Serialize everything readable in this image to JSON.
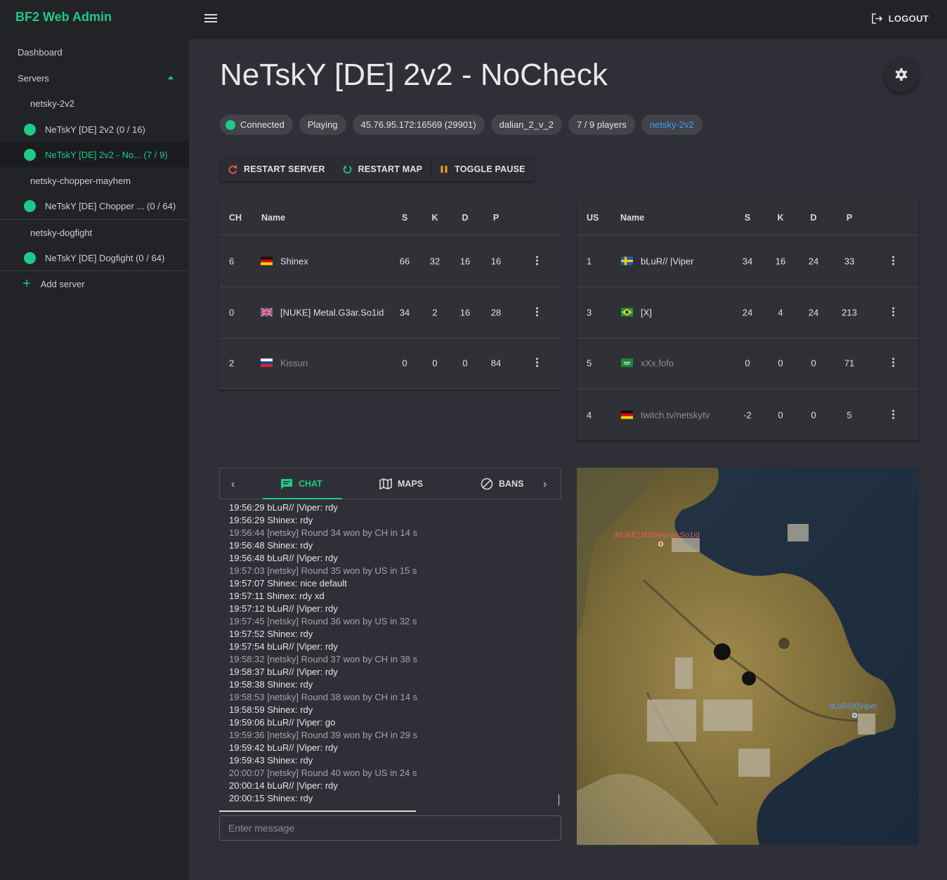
{
  "app": {
    "brand": "BF2 Web Admin",
    "logout_label": "LOGOUT"
  },
  "sidebar": {
    "dashboard": "Dashboard",
    "servers_label": "Servers",
    "groups": [
      {
        "name": "netsky-2v2",
        "servers": [
          "NeTskY [DE] 2v2 (0 / 16)",
          "NeTskY [DE] 2v2 - No... (7 / 9)"
        ]
      },
      {
        "name": "netsky-chopper-mayhem",
        "servers": [
          "NeTskY [DE] Chopper ... (0 / 64)"
        ]
      },
      {
        "name": "netsky-dogfight",
        "servers": [
          "NeTskY [DE] Dogfight (0 / 64)"
        ]
      }
    ],
    "add_server": "Add server"
  },
  "server": {
    "title": "NeTskY [DE] 2v2 - NoCheck",
    "chips": [
      "Connected",
      "Playing",
      "45.76.95.172:16569 (29901)",
      "dalian_2_v_2",
      "7 / 9 players",
      "netsky-2v2"
    ],
    "actions": [
      "RESTART SERVER",
      "RESTART MAP",
      "TOGGLE PAUSE"
    ]
  },
  "team_ch": {
    "headers": [
      "CH",
      "Name",
      "S",
      "K",
      "D",
      "P"
    ],
    "rows": [
      [
        "6",
        "Shinex",
        "66",
        "32",
        "16",
        "16"
      ],
      [
        "0",
        "[NUKE] Metal.G3ar.So1id",
        "34",
        "2",
        "16",
        "28"
      ],
      [
        "2",
        "Kissuri",
        "0",
        "0",
        "0",
        "84"
      ]
    ],
    "flags": [
      "de",
      "gb",
      "ru"
    ]
  },
  "team_us": {
    "headers": [
      "US",
      "Name",
      "S",
      "K",
      "D",
      "P"
    ],
    "rows": [
      [
        "1",
        "bLuR// |Viper",
        "34",
        "16",
        "24",
        "33"
      ],
      [
        "3",
        "[X]",
        "24",
        "4",
        "24",
        "213"
      ],
      [
        "5",
        "xXx.fofo",
        "0",
        "0",
        "0",
        "71"
      ],
      [
        "4",
        "twitch.tv/netskytv",
        "-2",
        "0",
        "0",
        "5"
      ]
    ],
    "flags": [
      "se",
      "br",
      "sa",
      "de"
    ]
  },
  "tabs": [
    "CHAT",
    "MAPS",
    "BANS"
  ],
  "chat": [
    "19:56:29 bLuR// |Viper: rdy",
    "19:56:29 Shinex: rdy",
    "19:56:44 [netsky] Round 34 won by CH in 14 s",
    "19:56:48 Shinex: rdy",
    "19:56:48 bLuR// |Viper: rdy",
    "19:57:03 [netsky] Round 35 won by US in 15 s",
    "19:57:07 Shinex: nice default",
    "19:57:11 Shinex: rdy xd",
    "19:57:12 bLuR// |Viper: rdy",
    "19:57:45 [netsky] Round 36 won by US in 32 s",
    "19:57:52 Shinex: rdy",
    "19:57:54 bLuR// |Viper: rdy",
    "19:58:32 [netsky] Round 37 won by CH in 38 s",
    "19:58:37 bLuR// |Viper: rdy",
    "19:58:38 Shinex: rdy",
    "19:58:53 [netsky] Round 38 won by CH in 14 s",
    "19:58:59 Shinex: rdy",
    "19:59:06 bLuR// |Viper: go",
    "19:59:36 [netsky] Round 39 won by CH in 29 s",
    "19:59:42 bLuR// |Viper: rdy",
    "19:59:43 Shinex: rdy",
    "20:00:07 [netsky] Round 40 won by US in 24 s",
    "20:00:14 bLuR// |Viper: rdy",
    "20:00:15 Shinex: rdy"
  ],
  "input": {
    "placeholder": "Enter message"
  },
  "map": {
    "label_ch": "[NUKE] MShinexar.So1id",
    "label_us": "bLuR/[X]Viper"
  },
  "colors": {
    "accent": "#1fca86",
    "link": "#3f9bf3",
    "ch": "#e65a5a",
    "us": "#5a9aee"
  }
}
